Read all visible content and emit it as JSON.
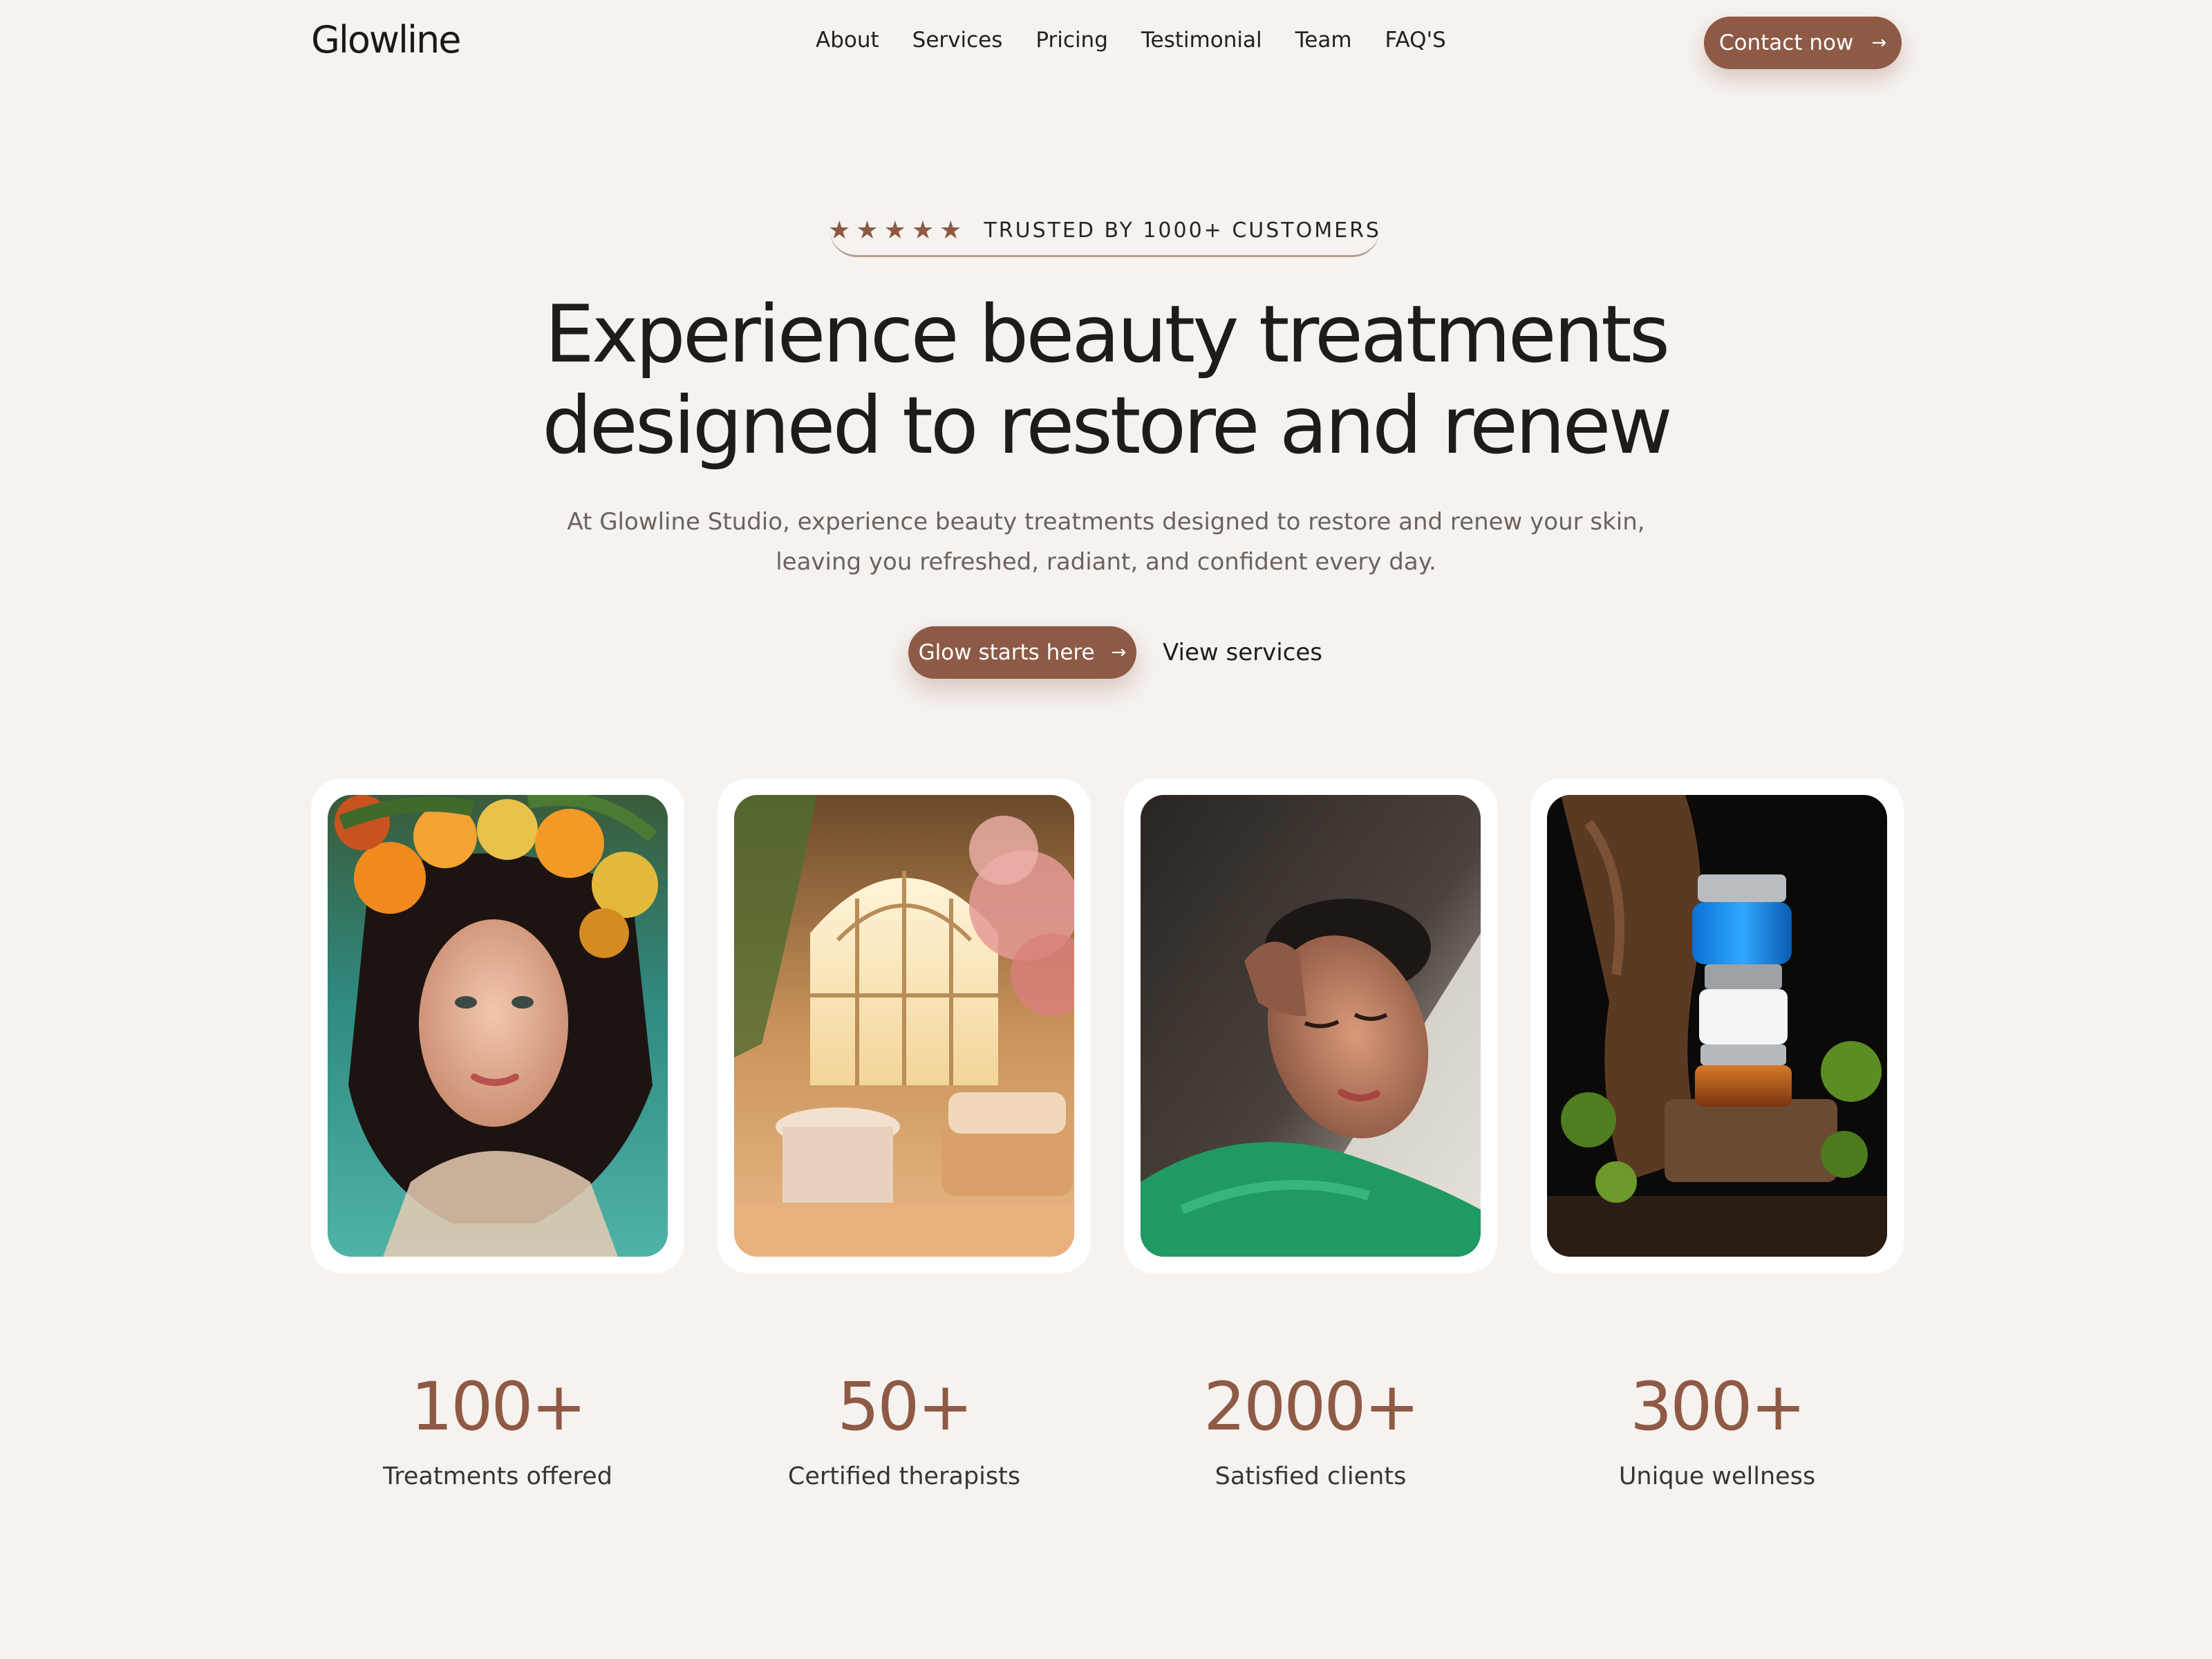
{
  "brand": {
    "logo_text": "Glowline",
    "accent_color": "#8e5a45",
    "background": "#f6f2ef"
  },
  "nav": {
    "links": [
      "About",
      "Services",
      "Pricing",
      "Testimonial",
      "Team",
      "FAQ'S"
    ],
    "cta_label": "Contact now",
    "cta_icon": "arrow-right-icon"
  },
  "hero": {
    "trust_stars": 5,
    "trust_text": "TRUSTED BY 1000+ CUSTOMERS",
    "headline_line1": "Experience beauty treatments",
    "headline_line2": "designed to restore and renew",
    "subtext_line1": "At Glowline Studio, experience beauty treatments designed to restore and renew your skin,",
    "subtext_line2": "leaving you refreshed, radiant, and confident every day.",
    "primary_cta": "Glow starts here",
    "secondary_cta": "View services"
  },
  "gallery": {
    "images": [
      {
        "name": "woman-with-citrus-fruits-photo"
      },
      {
        "name": "sunlit-interior-lounge-photo"
      },
      {
        "name": "relaxed-woman-in-sunlight-photo"
      },
      {
        "name": "stacked-skincare-jars-photo"
      }
    ]
  },
  "stats": [
    {
      "value": "100+",
      "label": "Treatments offered"
    },
    {
      "value": "50+",
      "label": "Certified therapists"
    },
    {
      "value": "2000+",
      "label": "Satisfied clients"
    },
    {
      "value": "300+",
      "label": "Unique wellness"
    }
  ]
}
